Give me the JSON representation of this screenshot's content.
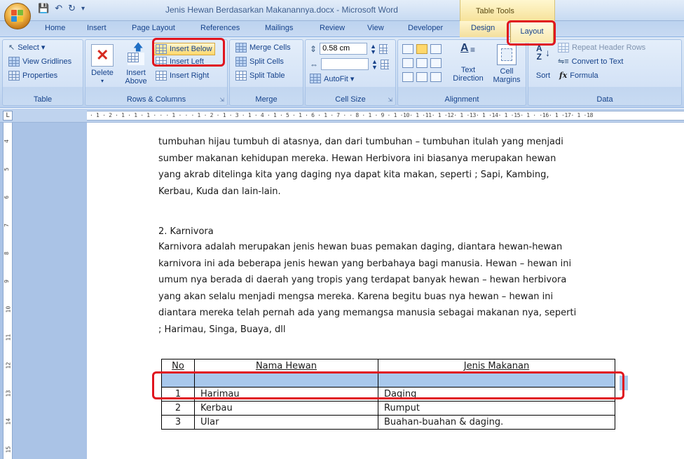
{
  "titlebar": {
    "quick_access": [
      "save-icon",
      "undo-icon",
      "redo-icon",
      "customize-icon"
    ],
    "title": "Jenis Hewan Berdasarkan Makanannya.docx - Microsoft Word",
    "context_tab": "Table Tools"
  },
  "tabs": [
    "Home",
    "Insert",
    "Page Layout",
    "References",
    "Mailings",
    "Review",
    "View",
    "Developer",
    "Design",
    "Layout"
  ],
  "ribbon": {
    "table": {
      "label": "Table",
      "select": "Select ▾",
      "view_gridlines": "View Gridlines",
      "properties": "Properties"
    },
    "rows_columns": {
      "label": "Rows & Columns",
      "delete": "Delete",
      "insert_above_1": "Insert",
      "insert_above_2": "Above",
      "insert_below": "Insert Below",
      "insert_left": "Insert Left",
      "insert_right": "Insert Right"
    },
    "merge": {
      "label": "Merge",
      "merge_cells": "Merge Cells",
      "split_cells": "Split Cells",
      "split_table": "Split Table"
    },
    "cell_size": {
      "label": "Cell Size",
      "height_value": "0.58 cm",
      "width_value": "",
      "autofit": "AutoFit ▾"
    },
    "alignment": {
      "label": "Alignment",
      "text_direction_1": "Text",
      "text_direction_2": "Direction",
      "cell_margins_1": "Cell",
      "cell_margins_2": "Margins"
    },
    "data": {
      "label": "Data",
      "sort": "Sort",
      "repeat_header_rows": "Repeat Header Rows",
      "convert_to_text": "Convert to Text",
      "formula": "Formula"
    }
  },
  "ruler": {
    "horizontal": "· 1 · 2 · 1 · 1 · 1 · · · 1 · · · 1 · 2 · 1 · 3 · 1 · 4 · 1 · 5 · 1 · 6 · 1 · 7 · · 8 · 1 · 9 · 1 ·10· 1 ·11· 1 ·12· 1 ·13· 1 ·14· 1 ·15· 1 · ·16· 1 ·17· 1 ·18",
    "vertical": [
      "4",
      "5",
      "6",
      "7",
      "8",
      "9",
      "10",
      "11",
      "12",
      "13",
      "14",
      "15"
    ]
  },
  "document": {
    "para1": [
      "tumbuhan hijau tumbuh di atasnya, dan dari tumbuhan – tumbuhan itulah yang menjadi",
      "sumber makanan kehidupan mereka. Hewan Herbivora ini biasanya merupakan hewan",
      "yang akrab ditelinga kita yang daging nya dapat kita makan, seperti ; Sapi, Kambing,",
      "Kerbau, Kuda dan lain-lain."
    ],
    "heading2": "2. Karnivora",
    "para2": [
      "Karnivora adalah merupakan jenis hewan buas pemakan daging, diantara hewan-hewan",
      "karnivora ini ada beberapa jenis hewan yang berbahaya bagi manusia. Hewan – hewan ini",
      "umum nya berada di daerah yang tropis yang terdapat banyak hewan – hewan herbivora",
      "yang akan selalu menjadi mengsa mereka. Karena begitu buas nya hewan – hewan ini",
      "diantara mereka telah pernah ada yang memangsa manusia sebagai makanan nya, seperti",
      "; Harimau, Singa, Buaya, dll"
    ],
    "table": {
      "headers": [
        "No",
        "Nama Hewan",
        "Jenis Makanan"
      ],
      "rows": [
        [
          "",
          "",
          ""
        ],
        [
          "1",
          "Harimau",
          "Daging"
        ],
        [
          "2",
          "Kerbau",
          "Rumput"
        ],
        [
          "3",
          "Ular",
          "Buahan-buahan & daging."
        ]
      ]
    }
  },
  "colors": {
    "highlight": "#e0141e",
    "selection": "#a8c8ec",
    "ribbon": "#c8dbf2"
  }
}
